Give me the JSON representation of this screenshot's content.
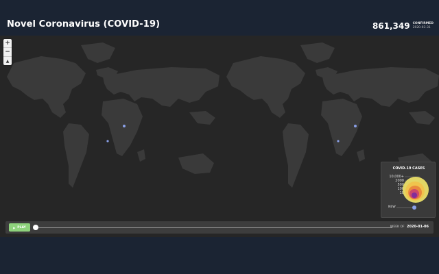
{
  "header": {
    "title": "Novel Coronavirus (COVID-19)",
    "count": "861,349",
    "count_label": "CONFIRMED",
    "date": "2020-03-31"
  },
  "zoom": {
    "in": "+",
    "out": "−",
    "reset": "▲"
  },
  "legend": {
    "title": "COVID-19 CASES",
    "labels": [
      "10,000+",
      "2000",
      "500",
      "100",
      "10"
    ],
    "new_label": "NEW",
    "colors": [
      "#f4e86a",
      "#f2c24a",
      "#e8843c",
      "#c94070",
      "#7a2aa0"
    ],
    "new_color": "#8aa0e8"
  },
  "timeline": {
    "play_label": "PLAY",
    "week_label": "WEEK OF",
    "week_value": "2020-01-06"
  },
  "colors": {
    "background": "#1b2433",
    "map_ocean": "#262626",
    "map_land": "#3a3a3a",
    "play": "#8ed27c"
  }
}
